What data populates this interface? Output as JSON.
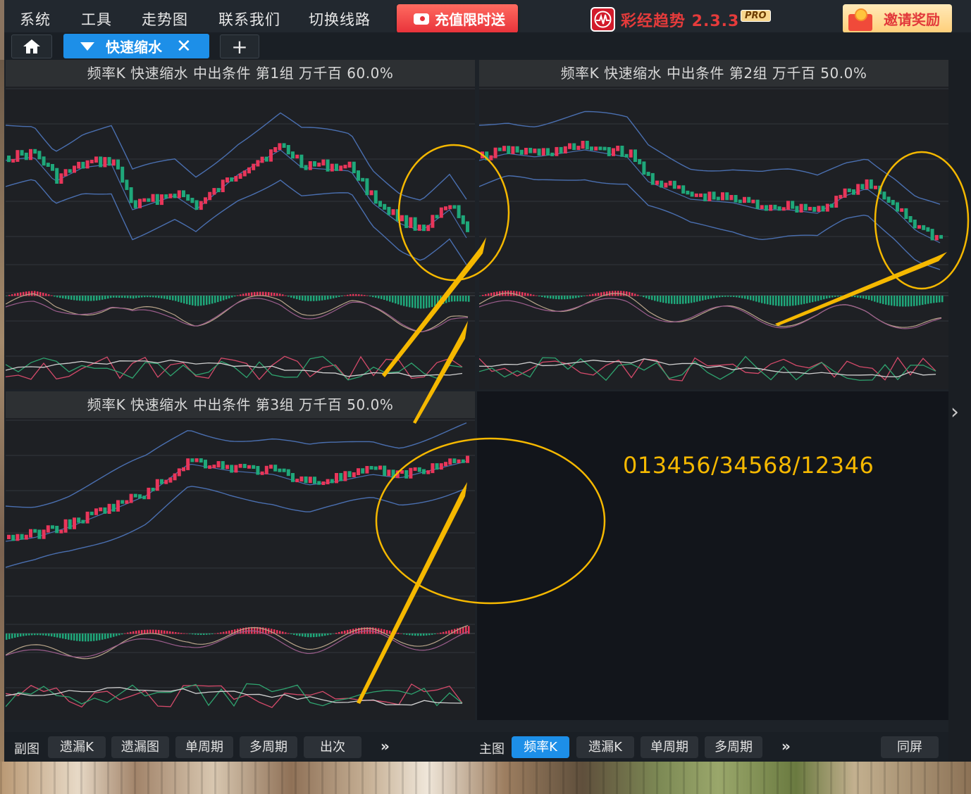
{
  "menu": {
    "items": [
      "系统",
      "工具",
      "走势图",
      "联系我们",
      "切换线路"
    ],
    "promo_label": "充值限时送",
    "logo_text": "彩经趋势 2.3.3",
    "logo_badge": "PRO",
    "invite_label": "邀请奖励"
  },
  "tabs": {
    "active_label": "快速缩水",
    "close_glyph": "✕",
    "add_glyph": "+"
  },
  "panels": [
    {
      "title": "频率K  快速缩水  中出条件 第1组  万千百  60.0%"
    },
    {
      "title": "频率K  快速缩水  中出条件 第2组  万千百  50.0%"
    },
    {
      "title": "频率K  快速缩水  中出条件 第3组  万千百  50.0%"
    }
  ],
  "note_text": "013456/34568/12346",
  "side_arrow": "›",
  "bottom": {
    "left_label": "副图",
    "left_buttons": [
      "遗漏K",
      "遗漏图",
      "单周期",
      "多周期",
      "出次"
    ],
    "left_more": "»",
    "right_label": "主图",
    "right_buttons": [
      "频率K",
      "遗漏K",
      "单周期",
      "多周期"
    ],
    "right_active": "频率K",
    "right_more": "»",
    "same_screen": "同屏"
  },
  "colors": {
    "up": "#e8365a",
    "down": "#1fa77a",
    "band": "#4a6fb0",
    "annotation": "#f5b800",
    "accent": "#1d8fe8"
  }
}
